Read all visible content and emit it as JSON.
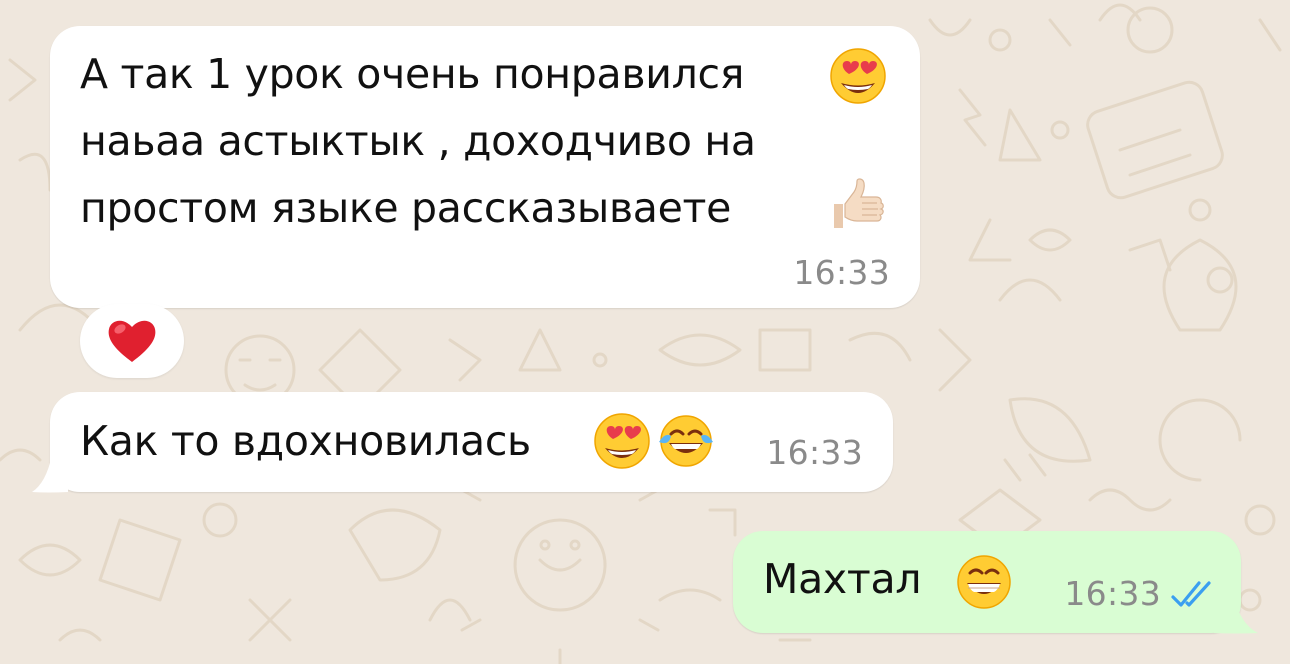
{
  "chat": {
    "messages": [
      {
        "direction": "incoming",
        "text": "А так 1 урок очень понравился\nнаьаа астыктык , доходчиво на\nпростом языке рассказываете",
        "emojis": [
          "heart-eyes-emoji",
          "thumbs-up-emoji"
        ],
        "time": "16:33",
        "reaction": "❤️"
      },
      {
        "direction": "incoming",
        "text": "Как то вдохновилась",
        "emojis": [
          "heart-eyes-emoji",
          "tears-of-joy-emoji"
        ],
        "time": "16:33"
      },
      {
        "direction": "outgoing",
        "text": "Махтал",
        "emojis": [
          "grinning-emoji"
        ],
        "time": "16:33",
        "status": "read"
      }
    ]
  },
  "colors": {
    "background": "#efe7dd",
    "incoming_bubble": "#ffffff",
    "outgoing_bubble": "#d9fdd3",
    "read_check": "#3b9ff0",
    "timestamp": "#8a8a8a"
  },
  "icons": {
    "read_status": "double-check-icon",
    "reaction": "heart-reaction-icon"
  }
}
